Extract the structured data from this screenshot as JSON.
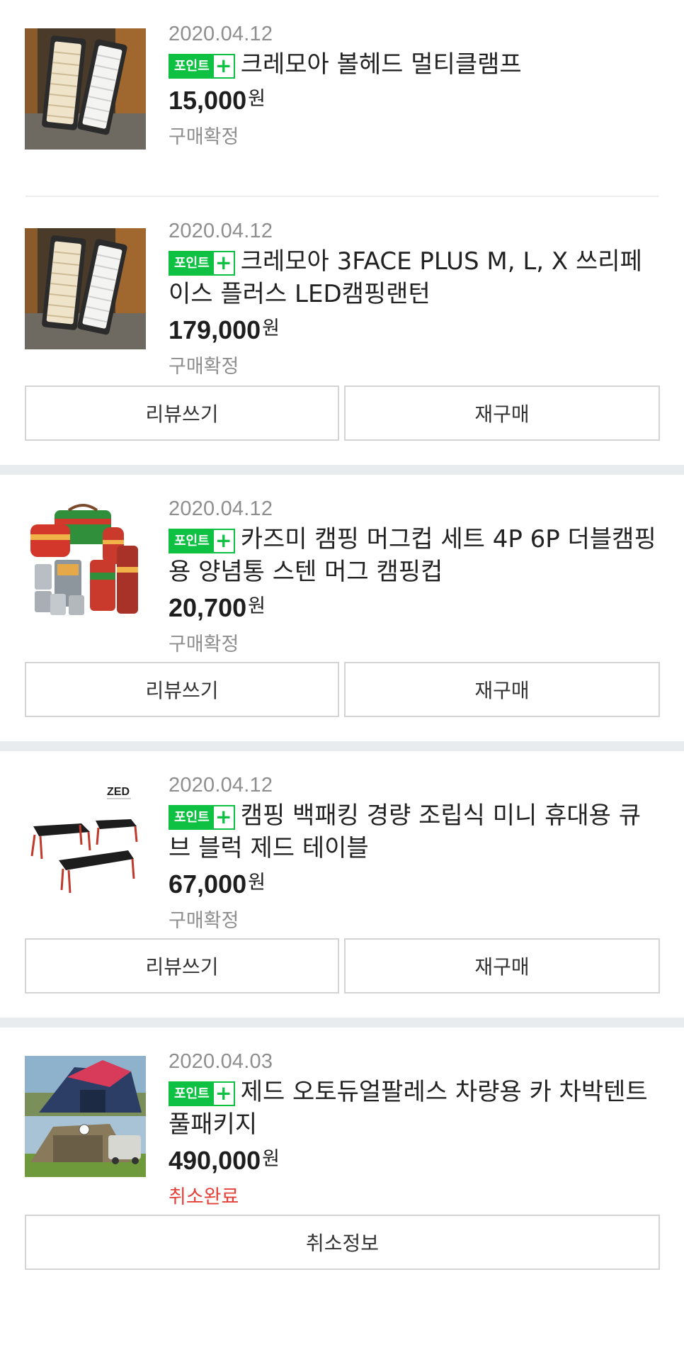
{
  "orders": [
    {
      "date": "2020.04.12",
      "badge": {
        "text": "포인트",
        "plus": "+"
      },
      "title": "크레모아 볼헤드 멀티클램프",
      "price": "15,000",
      "currency": "원",
      "status": "구매확정"
    },
    {
      "date": "2020.04.12",
      "badge": {
        "text": "포인트",
        "plus": "+"
      },
      "title": "크레모아 3FACE PLUS M, L, X 쓰리페이스 플러스 LED캠핑랜턴",
      "price": "179,000",
      "currency": "원",
      "status": "구매확정",
      "buttons": {
        "review": "리뷰쓰기",
        "rebuy": "재구매"
      }
    },
    {
      "date": "2020.04.12",
      "badge": {
        "text": "포인트",
        "plus": "+"
      },
      "title": "카즈미 캠핑 머그컵 세트 4P 6P 더블캠핑용 양념통 스텐 머그 캠핑컵",
      "price": "20,700",
      "currency": "원",
      "status": "구매확정",
      "buttons": {
        "review": "리뷰쓰기",
        "rebuy": "재구매"
      }
    },
    {
      "date": "2020.04.12",
      "badge": {
        "text": "포인트",
        "plus": "+"
      },
      "title": "캠핑 백패킹 경량 조립식 미니 휴대용 큐브 블럭 제드 테이블",
      "price": "67,000",
      "currency": "원",
      "status": "구매확정",
      "buttons": {
        "review": "리뷰쓰기",
        "rebuy": "재구매"
      }
    },
    {
      "date": "2020.04.03",
      "badge": {
        "text": "포인트",
        "plus": "+"
      },
      "title": "제드 오토듀얼팔레스 차량용 카 차박텐트 풀패키지",
      "price": "490,000",
      "currency": "원",
      "status": "취소완료",
      "buttons": {
        "cancel_info": "취소정보"
      }
    }
  ],
  "colors": {
    "badge_green": "#0ec143",
    "status_gray": "#8e8e8e",
    "status_cancel": "#e6403a",
    "section_divider": "#e9ecef"
  },
  "icons": {
    "badge_plus": "plus-icon"
  },
  "thumbnail_text": {
    "table_logo": "ZED"
  }
}
